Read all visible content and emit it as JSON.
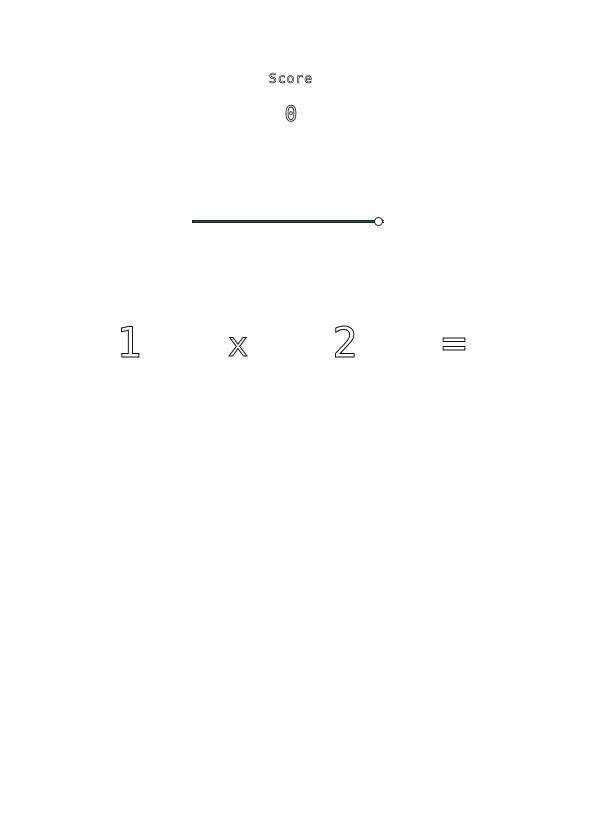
{
  "score": {
    "label": "Score",
    "value": "0"
  },
  "timer": {
    "progress": 0.97,
    "fill_color": "#1d5a3a"
  },
  "equation": {
    "operand_a": "1",
    "operator": "x",
    "operand_b": "2",
    "equals": "="
  }
}
